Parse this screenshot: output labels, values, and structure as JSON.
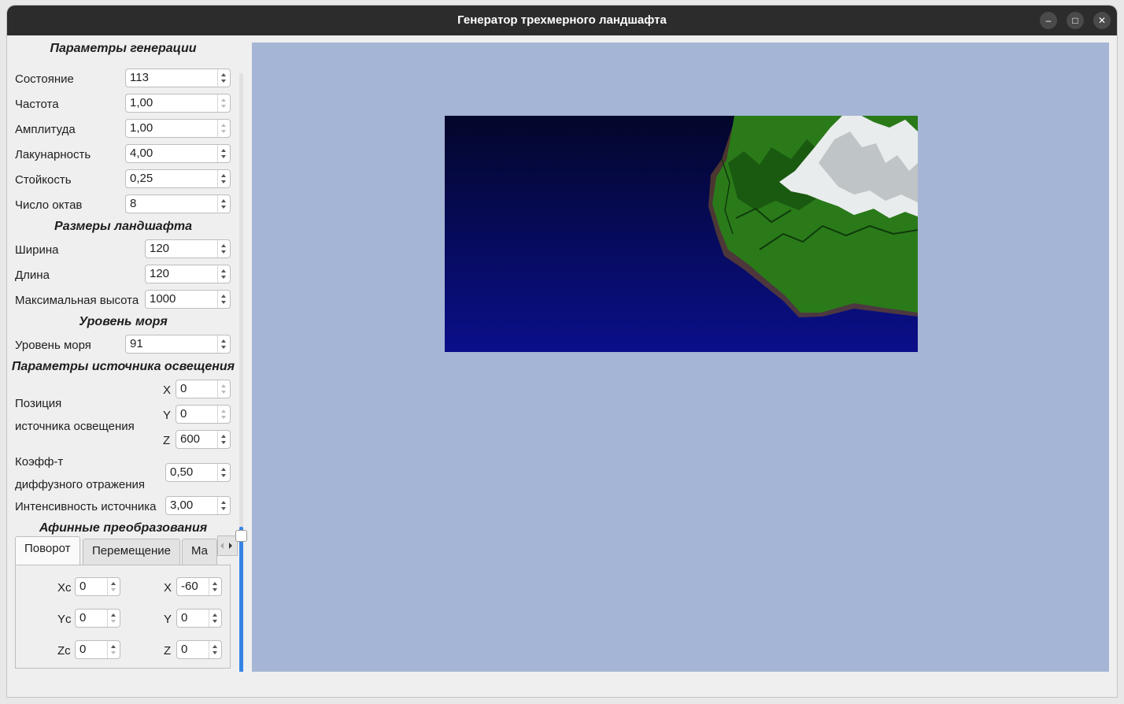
{
  "window": {
    "title": "Генератор трехмерного ландшафта"
  },
  "titlebar_buttons": {
    "minimize": "–",
    "maximize": "□",
    "close": "✕"
  },
  "generation": {
    "header": "Параметры генерации",
    "fields": [
      {
        "label": "Состояние",
        "value": "113"
      },
      {
        "label": "Частота",
        "value": "1,00"
      },
      {
        "label": "Амплитуда",
        "value": "1,00"
      },
      {
        "label": "Лакунарность",
        "value": "4,00"
      },
      {
        "label": "Стойкость",
        "value": "0,25"
      },
      {
        "label": "Число октав",
        "value": "8"
      }
    ]
  },
  "size": {
    "header": "Размеры ландшафта",
    "fields": [
      {
        "label": "Ширина",
        "value": "120"
      },
      {
        "label": "Длина",
        "value": "120"
      },
      {
        "label": "Максимальная высота",
        "value": "1000"
      }
    ]
  },
  "sea": {
    "header": "Уровень моря",
    "label": "Уровень моря",
    "value": "91"
  },
  "light": {
    "header": "Параметры источника освещения",
    "position_label_1": "Позиция",
    "position_label_2": "источника освещения",
    "x_label": "X",
    "x_value": "0",
    "y_label": "Y",
    "y_value": "0",
    "z_label": "Z",
    "z_value": "600",
    "diffuse_label_1": "Коэфф-т",
    "diffuse_label_2": "диффузного отражения",
    "diffuse_value": "0,50",
    "intensity_label": "Интенсивность источника",
    "intensity_value": "3,00"
  },
  "affine": {
    "header": "Афинные преобразования",
    "tabs": [
      "Поворот",
      "Перемещение",
      "Ма"
    ],
    "rotation": {
      "xc_label": "Xc",
      "xc_value": "0",
      "yc_label": "Yc",
      "yc_value": "0",
      "zc_label": "Zc",
      "zc_value": "0",
      "x_label": "X",
      "x_value": "-60",
      "y_label": "Y",
      "y_value": "0",
      "z_label": "Z",
      "z_value": "0"
    }
  },
  "colors": {
    "viewport_bg": "#a5b5d5",
    "water_top": "#03062a",
    "water_bottom": "#0a0f8a",
    "grass": "#2a7a1a",
    "snow": "#f2f4f4",
    "accent": "#3584e4"
  },
  "panel_scroll_level": 0.72
}
